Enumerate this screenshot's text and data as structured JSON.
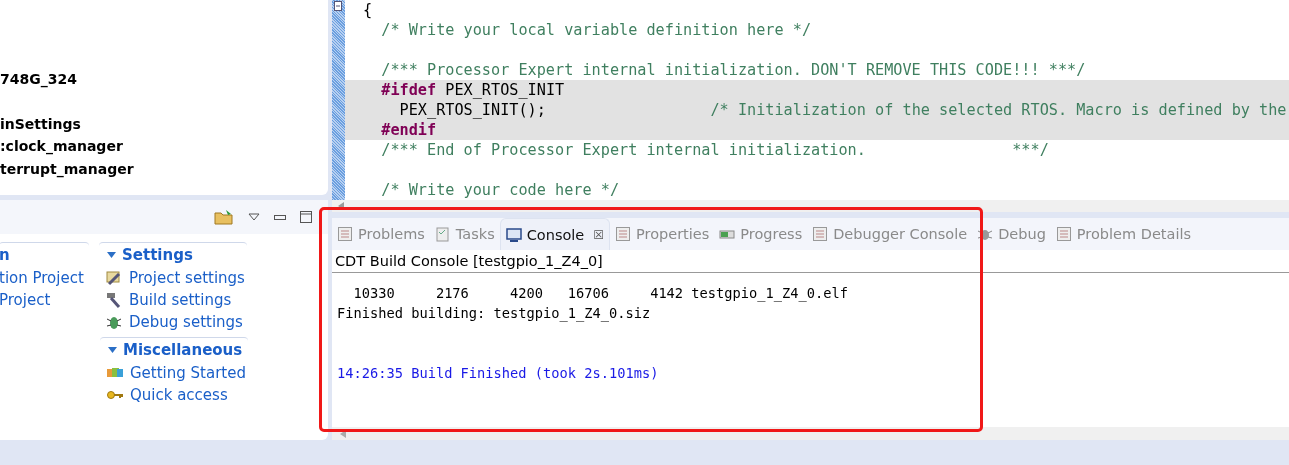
{
  "project_tree": {
    "rows": [
      {
        "kind": "blank"
      },
      {
        "kind": "blank"
      },
      {
        "kind": "blank"
      },
      {
        "kind": "label",
        "text": "748G_324"
      },
      {
        "kind": "blank"
      },
      {
        "kind": "label",
        "text": "inSettings"
      },
      {
        "kind": "label",
        "text": ":clock_manager"
      },
      {
        "kind": "label",
        "text": "terrupt_manager"
      }
    ]
  },
  "quick_start": {
    "sections": [
      {
        "heading": "n",
        "items": [
          {
            "label": "tion Project"
          },
          {
            "label": "Project"
          }
        ]
      },
      {
        "heading": "Settings",
        "items": [
          {
            "label": "Project settings"
          },
          {
            "label": "Build settings"
          },
          {
            "label": "Debug settings"
          }
        ]
      },
      {
        "heading": "Miscellaneous",
        "items": [
          {
            "label": "Getting Started"
          },
          {
            "label": "Quick access"
          }
        ]
      }
    ]
  },
  "editor": {
    "lines": [
      {
        "kind": "code",
        "highlighted": false,
        "segments": [
          {
            "kind": "plain",
            "text": "{"
          }
        ]
      },
      {
        "kind": "code",
        "highlighted": false,
        "segments": [
          {
            "kind": "comment",
            "text": "  /* Write your local variable definition here */"
          }
        ]
      },
      {
        "kind": "blank"
      },
      {
        "kind": "code",
        "highlighted": false,
        "segments": [
          {
            "kind": "comment",
            "text": "  /*** Processor Expert internal initialization. DON'T REMOVE THIS CODE!!! ***/"
          }
        ]
      },
      {
        "kind": "code",
        "highlighted": true,
        "segments": [
          {
            "kind": "keyword",
            "text": "  #ifdef"
          },
          {
            "kind": "plain",
            "text": " PEX_RTOS_INIT"
          }
        ]
      },
      {
        "kind": "code",
        "highlighted": true,
        "segments": [
          {
            "kind": "plain",
            "text": "    PEX_RTOS_INIT();                  "
          },
          {
            "kind": "comment",
            "text": "/* Initialization of the selected RTOS. Macro is defined by the"
          }
        ]
      },
      {
        "kind": "code",
        "highlighted": true,
        "segments": [
          {
            "kind": "keyword",
            "text": "  #endif"
          }
        ]
      },
      {
        "kind": "code",
        "highlighted": false,
        "segments": [
          {
            "kind": "comment",
            "text": "  /*** End of Processor Expert internal initialization.                ***/"
          }
        ]
      },
      {
        "kind": "blank"
      },
      {
        "kind": "code",
        "highlighted": false,
        "segments": [
          {
            "kind": "comment",
            "text": "  /* Write your code here */"
          }
        ]
      }
    ]
  },
  "console_view": {
    "tabs": [
      {
        "label": "Problems",
        "selected": false
      },
      {
        "label": "Tasks",
        "selected": false
      },
      {
        "label": "Console",
        "selected": true,
        "close": "☒"
      },
      {
        "label": "Properties",
        "selected": false
      },
      {
        "label": "Progress",
        "selected": false
      },
      {
        "label": "Debugger Console",
        "selected": false
      },
      {
        "label": "Debug",
        "selected": false
      },
      {
        "label": "Problem Details",
        "selected": false
      }
    ],
    "title": "CDT Build Console [testgpio_1_Z4_0]",
    "lines": [
      {
        "kind": "clipped"
      },
      {
        "kind": "normal",
        "text": "  10330     2176     4200   16706     4142 testgpio_1_Z4_0.elf"
      },
      {
        "kind": "normal",
        "text": "Finished building: testgpio_1_Z4_0.siz"
      },
      {
        "kind": "blank"
      },
      {
        "kind": "blank"
      },
      {
        "kind": "info",
        "text": "14:26:35 Build Finished (took 2s.101ms)"
      }
    ]
  }
}
